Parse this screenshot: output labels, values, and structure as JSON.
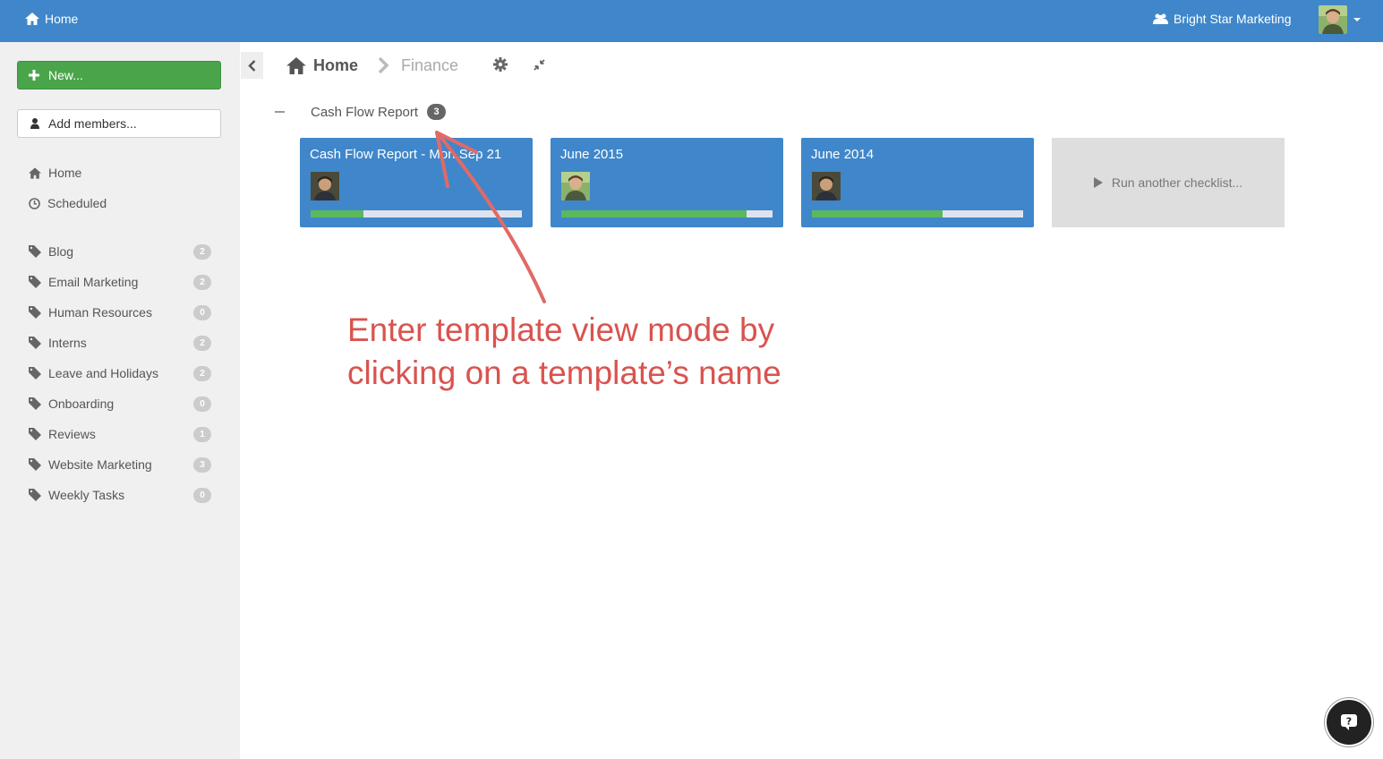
{
  "topbar": {
    "home_label": "Home",
    "org_name": "Bright Star Marketing",
    "home_icon": "home-icon",
    "org_icon": "users-icon",
    "accent_color": "#3f87ca"
  },
  "sidebar": {
    "new_button": "New...",
    "add_members_button": "Add members...",
    "nav": [
      {
        "label": "Home",
        "icon": "home-icon"
      },
      {
        "label": "Scheduled",
        "icon": "clock-icon"
      }
    ],
    "tags": [
      {
        "label": "Blog",
        "count": "2"
      },
      {
        "label": "Email Marketing",
        "count": "2"
      },
      {
        "label": "Human Resources",
        "count": "0"
      },
      {
        "label": "Interns",
        "count": "2"
      },
      {
        "label": "Leave and Holidays",
        "count": "2"
      },
      {
        "label": "Onboarding",
        "count": "0"
      },
      {
        "label": "Reviews",
        "count": "1"
      },
      {
        "label": "Website Marketing",
        "count": "3"
      },
      {
        "label": "Weekly Tasks",
        "count": "0"
      }
    ]
  },
  "breadcrumb": {
    "home": "Home",
    "current": "Finance"
  },
  "section": {
    "title": "Cash Flow Report",
    "count": "3"
  },
  "cards": [
    {
      "title": "Cash Flow Report - Mon Sep 21",
      "progress": 0.25
    },
    {
      "title": "June 2015",
      "progress": 0.875
    },
    {
      "title": "June 2014",
      "progress": 0.62
    }
  ],
  "run_another": "Run another checklist...",
  "annotation": {
    "line1": "Enter template view mode by",
    "line2": "clicking on a template’s name",
    "color": "#d9534f"
  }
}
